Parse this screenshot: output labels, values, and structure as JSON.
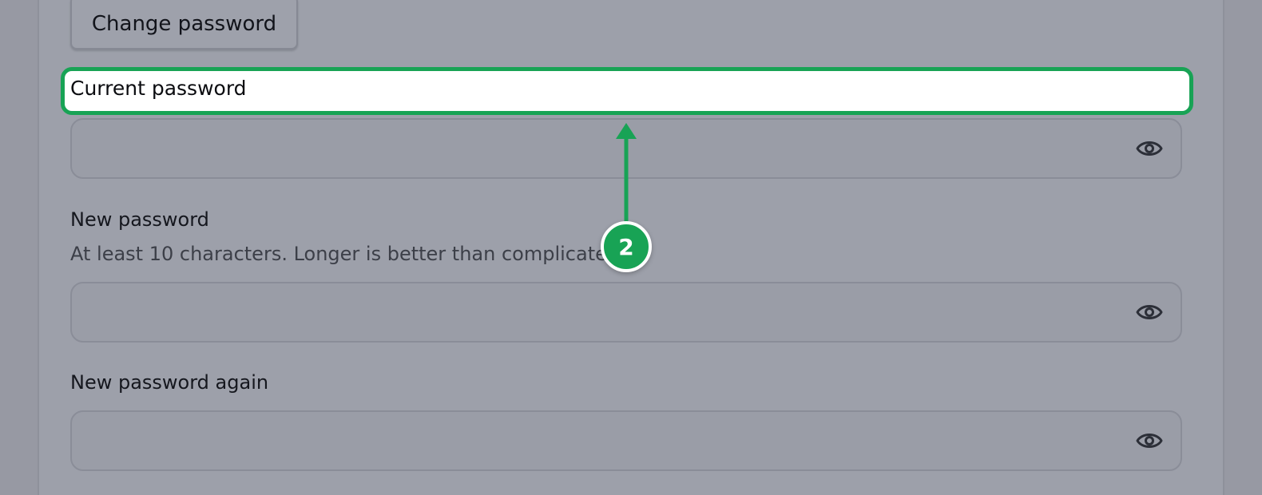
{
  "buttons": {
    "change_password": "Change password"
  },
  "fields": {
    "current": {
      "label": "Current password",
      "value": ""
    },
    "new": {
      "label": "New password",
      "hint": "At least 10 characters. Longer is better than complicated.",
      "value": ""
    },
    "new_again": {
      "label": "New password again",
      "value": ""
    }
  },
  "icons": {
    "reveal_password": "eye-icon"
  },
  "annotation": {
    "step_number": "2",
    "highlight_color": "#18a355"
  }
}
